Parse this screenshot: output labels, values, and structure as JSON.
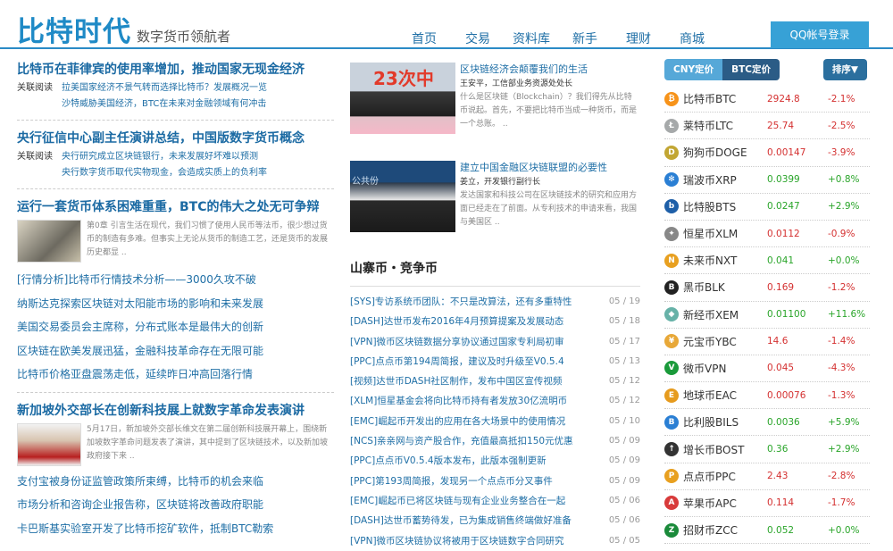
{
  "header": {
    "logo": "比特时代",
    "slogan": "数字货币领航者",
    "nav": [
      "首页",
      "交易",
      "资料库",
      "新手",
      "理财",
      "商城"
    ],
    "login": "QQ帐号登录"
  },
  "left": {
    "sec1": {
      "title": "比特币在菲律宾的使用率增加，推动国家无现金经济",
      "label": "关联阅读",
      "links": [
        "拉美国家经济不景气转而选择比特币？发展概况一览",
        "沙特威胁美国经济，BTC在未来对金融领域有何冲击"
      ]
    },
    "sec2": {
      "title": "央行征信中心副主任演讲总结，中国版数字货币概念",
      "label": "关联阅读",
      "links": [
        "央行研究成立区块链银行，未来发展好坏难以预测",
        "央行数字货币取代实物现金，会造成实质上的负利率"
      ]
    },
    "sec3": {
      "title": "运行一套货币体系困难重重，BTC的伟大之处无可争辩",
      "desc": "第0章 引言生活在现代，我们习惯了使用人民币等法币，很少想过货币的制造有多难。但事实上无论从货币的制造工艺，还是货币的发展历史都显 .."
    },
    "list": [
      "[行情分析]比特币行情技术分析——3000久攻不破",
      "纳斯达克探索区块链对太阳能市场的影响和未来发展",
      "美国交易委员会主席称，分布式账本是最伟大的创新",
      "区块链在欧美发展迅猛，金融科技革命存在无限可能",
      "比特币价格亚盘震荡走低，延续昨日冲高回落行情"
    ],
    "sec4": {
      "title": "新加坡外交部长在创新科技展上就数字革命发表演讲",
      "desc": "5月17日，新加坡外交部长维文在第二届创新科技展开幕上，围绕新加坡数字革命问题发表了演讲，其中提到了区块链技术，以及新加坡政府接下来 .."
    },
    "list2": [
      "支付宝被身份证监管政策所束缚，比特币的机会来临",
      "市场分析和咨询企业报告称，区块链将改善政府职能",
      "卡巴斯基实验室开发了比特币挖矿软件，抵制BTC勒索"
    ]
  },
  "middle": {
    "feature1": {
      "img_text": "23次中",
      "title": "区块链经济会颠覆我们的生活",
      "author": "王安平，工信部业务资源处处长",
      "desc": "什么是区块链（Blockchain）？我们得先从比特币说起。首先，不要把比特币当成一种货币，而是一个总账。 .."
    },
    "feature2": {
      "img_text": "公共份",
      "title": "建立中国金融区块链联盟的必要性",
      "author": "姜立，开发银行副行长",
      "desc": "发达国家和科技公司在区块链技术的研究和应用方面已经走在了前面。从专利技术的申请来看，我国与美国区 .."
    },
    "section_title": "山寨币・竞争币",
    "news": [
      {
        "t": "[SYS]专访系统币团队：不只是改算法，还有多重特性",
        "d": "05 / 19"
      },
      {
        "t": "[DASH]达世币发布2016年4月预算提案及发展动态",
        "d": "05 / 18"
      },
      {
        "t": "[VPN]微币区块链数据分享协议通过国家专利局初审",
        "d": "05 / 17"
      },
      {
        "t": "[PPC]点点币第194周简报，建议及时升级至V0.5.4",
        "d": "05 / 13"
      },
      {
        "t": "[视频]达世币DASH社区制作，发布中国区宣传视频",
        "d": "05 / 12"
      },
      {
        "t": "[XLM]恒星基金会将向比特币持有者发放30亿流明币",
        "d": "05 / 12"
      },
      {
        "t": "[EMC]崛起币开发出的应用在各大场景中的使用情况",
        "d": "05 / 10"
      },
      {
        "t": "[NCS]亲亲网与资产股合作，充值最高抵扣150元优惠",
        "d": "05 / 09"
      },
      {
        "t": "[PPC]点点币V0.5.4版本发布，此版本强制更新",
        "d": "05 / 09"
      },
      {
        "t": "[PPC]第193周简报，发现另一个点点币分叉事件",
        "d": "05 / 09"
      },
      {
        "t": "[EMC]崛起币已将区块链与现有企业业务整合在一起",
        "d": "05 / 06"
      },
      {
        "t": "[DASH]达世币蓄势待发，已为集成销售终端做好准备",
        "d": "05 / 06"
      },
      {
        "t": "[VPN]微币区块链协议将被用于区块链数字合同研究",
        "d": "05 / 05"
      }
    ]
  },
  "right": {
    "tab_cny": "CNY定价",
    "tab_btc": "BTC定价",
    "sort": "排序▼",
    "coins": [
      {
        "name": "比特币BTC",
        "price": "2924.8",
        "chg": "-2.1%",
        "dir": "dn",
        "icon": "bitcoin-icon",
        "color": "#f7931a",
        "glyph": "₿"
      },
      {
        "name": "莱特币LTC",
        "price": "25.74",
        "chg": "-2.5%",
        "dir": "dn",
        "icon": "litecoin-icon",
        "color": "#a6a9aa",
        "glyph": "Ł"
      },
      {
        "name": "狗狗币DOGE",
        "price": "0.00147",
        "chg": "-3.9%",
        "dir": "dn",
        "icon": "dogecoin-icon",
        "color": "#c2a633",
        "glyph": "D"
      },
      {
        "name": "瑞波币XRP",
        "price": "0.0399",
        "chg": "+0.8%",
        "dir": "up",
        "icon": "ripple-icon",
        "color": "#2a7fd4",
        "glyph": "✻"
      },
      {
        "name": "比特股BTS",
        "price": "0.0247",
        "chg": "+2.9%",
        "dir": "up",
        "icon": "bitshares-icon",
        "color": "#1e5fa8",
        "glyph": "b"
      },
      {
        "name": "恒星币XLM",
        "price": "0.0112",
        "chg": "-0.9%",
        "dir": "dn",
        "icon": "stellar-icon",
        "color": "#888888",
        "glyph": "✦"
      },
      {
        "name": "未来币NXT",
        "price": "0.041",
        "chg": "+0.0%",
        "dir": "up",
        "icon": "nxt-icon",
        "color": "#e8a020",
        "glyph": "N"
      },
      {
        "name": "黑币BLK",
        "price": "0.169",
        "chg": "-1.2%",
        "dir": "dn",
        "icon": "blackcoin-icon",
        "color": "#222222",
        "glyph": "B"
      },
      {
        "name": "新经币XEM",
        "price": "0.01100",
        "chg": "+11.6%",
        "dir": "up",
        "icon": "nem-icon",
        "color": "#67b2a8",
        "glyph": "◆"
      },
      {
        "name": "元宝币YBC",
        "price": "14.6",
        "chg": "-1.4%",
        "dir": "dn",
        "icon": "ybcoin-icon",
        "color": "#e8a838",
        "glyph": "¥"
      },
      {
        "name": "微币VPN",
        "price": "0.045",
        "chg": "-4.3%",
        "dir": "dn",
        "icon": "vpncoin-icon",
        "color": "#1a9a3a",
        "glyph": "V"
      },
      {
        "name": "地球币EAC",
        "price": "0.00076",
        "chg": "-1.3%",
        "dir": "dn",
        "icon": "earthcoin-icon",
        "color": "#e69b1e",
        "glyph": "E"
      },
      {
        "name": "比利股BILS",
        "price": "0.0036",
        "chg": "+5.9%",
        "dir": "up",
        "icon": "bils-icon",
        "color": "#2a7fd4",
        "glyph": "B"
      },
      {
        "name": "增长币BOST",
        "price": "0.36",
        "chg": "+2.9%",
        "dir": "up",
        "icon": "boostcoin-icon",
        "color": "#333333",
        "glyph": "↑"
      },
      {
        "name": "点点币PPC",
        "price": "2.43",
        "chg": "-2.8%",
        "dir": "dn",
        "icon": "peercoin-icon",
        "color": "#e8a020",
        "glyph": "P"
      },
      {
        "name": "苹果币APC",
        "price": "0.114",
        "chg": "-1.7%",
        "dir": "dn",
        "icon": "applecoin-icon",
        "color": "#d83a3a",
        "glyph": "A"
      },
      {
        "name": "招财币ZCC",
        "price": "0.052",
        "chg": "+0.0%",
        "dir": "up",
        "icon": "zcc-icon",
        "color": "#1a8a3a",
        "glyph": "Z"
      }
    ]
  }
}
